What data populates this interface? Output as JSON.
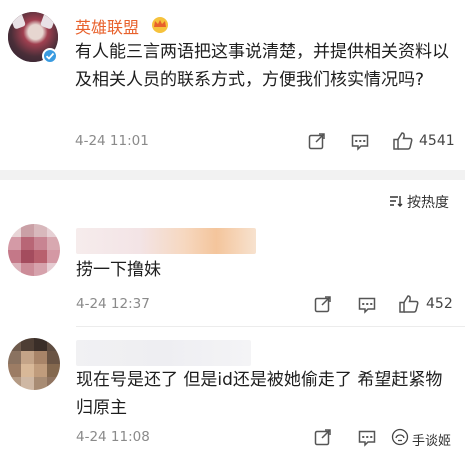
{
  "post": {
    "author": "英雄联盟",
    "text": "有人能三言两语把这事说清楚，并提供相关资料以及相关人员的联系方式，方便我们核实情况吗?",
    "time": "4-24 11:01",
    "likes": "4541"
  },
  "sort_label": "按热度",
  "comments": [
    {
      "text": "捞一下撸妹",
      "time": "4-24 12:37",
      "likes": "452"
    },
    {
      "text": "现在号是还了 但是id还是被她偷走了 希望赶紧物归原主",
      "time": "4-24 11:08",
      "likes": ""
    }
  ],
  "watermark": "手谈姬",
  "colors": {
    "accent": "#e8612c",
    "verified": "#3a9be0",
    "divider": "#f2f2f2"
  }
}
